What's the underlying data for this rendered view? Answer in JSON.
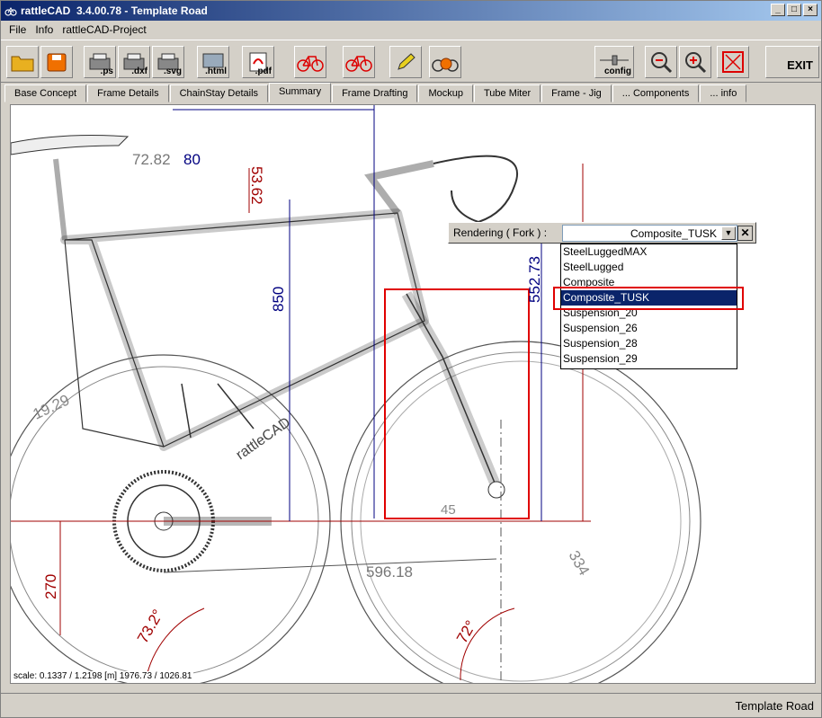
{
  "window": {
    "title": "rattleCAD  3.4.00.78 - Template Road"
  },
  "menu": [
    "File",
    "Info",
    "rattleCAD-Project"
  ],
  "toolbar": {
    "ps_label": ".ps",
    "dxf_label": ".dxf",
    "svg_label": ".svg",
    "html_label": ".html",
    "pdf_label": ".pdf",
    "config_label": "config",
    "exit_label": "EXIT"
  },
  "tabs": [
    "Base Concept",
    "Frame Details",
    "ChainStay Details",
    "Summary",
    "Frame Drafting",
    "Mockup",
    "Tube Miter",
    "Frame - Jig",
    "... Components",
    "... info"
  ],
  "active_tab": "Summary",
  "drawing": {
    "dims": [
      "72.82",
      "80",
      "53.62",
      "850",
      "552.73",
      "19.29",
      "596.18",
      "270",
      "73.2°",
      "72°",
      "45",
      "334"
    ],
    "frame_label": "rattleCAD"
  },
  "scale_text": "scale: 0.1337 / 1.2198  [m]  1976.73 / 1026.81",
  "rendering": {
    "label": "Rendering ( Fork ) :",
    "value": "Composite_TUSK",
    "options": [
      "SteelLuggedMAX",
      "SteelLugged",
      "Composite",
      "Composite_TUSK",
      "Suspension_20",
      "Suspension_26",
      "Suspension_28",
      "Suspension_29"
    ],
    "selected_index": 3
  },
  "status": "Template Road"
}
